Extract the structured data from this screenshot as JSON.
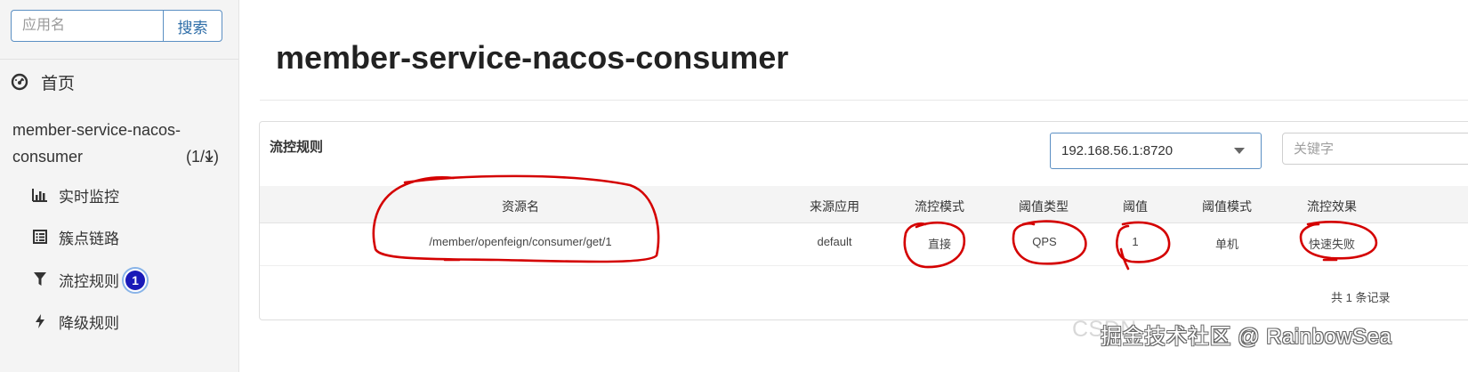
{
  "sidebar": {
    "search_placeholder": "应用名",
    "search_button": "搜索",
    "home_label": "首页",
    "app": {
      "name_line1": "member-service-nacos-",
      "name_line2": "consumer",
      "count": "(1/1)"
    },
    "menu": [
      {
        "label": "实时监控",
        "icon": "bar-chart-icon"
      },
      {
        "label": "簇点链路",
        "icon": "list-icon"
      },
      {
        "label": "流控规则",
        "icon": "filter-icon"
      },
      {
        "label": "降级规则",
        "icon": "bolt-icon"
      }
    ],
    "badge": "1"
  },
  "main": {
    "title": "member-service-nacos-consumer",
    "panel_title": "流控规则",
    "machine_select": "192.168.56.1:8720",
    "keyword_placeholder": "关键字",
    "columns": [
      "资源名",
      "来源应用",
      "流控模式",
      "阈值类型",
      "阈值",
      "阈值模式",
      "流控效果"
    ],
    "rows": [
      [
        "/member/openfeign/consumer/get/1",
        "default",
        "直接",
        "QPS",
        "1",
        "单机",
        "快速失败"
      ]
    ],
    "pagination": "共 1 条记录"
  },
  "watermark": {
    "back": "CSDN",
    "front": "掘金技术社区 @ RainbowSea"
  },
  "colors": {
    "accent_border": "#5b8fc3",
    "annotation_red": "#d40000",
    "badge_blue": "#1a1ab8"
  }
}
